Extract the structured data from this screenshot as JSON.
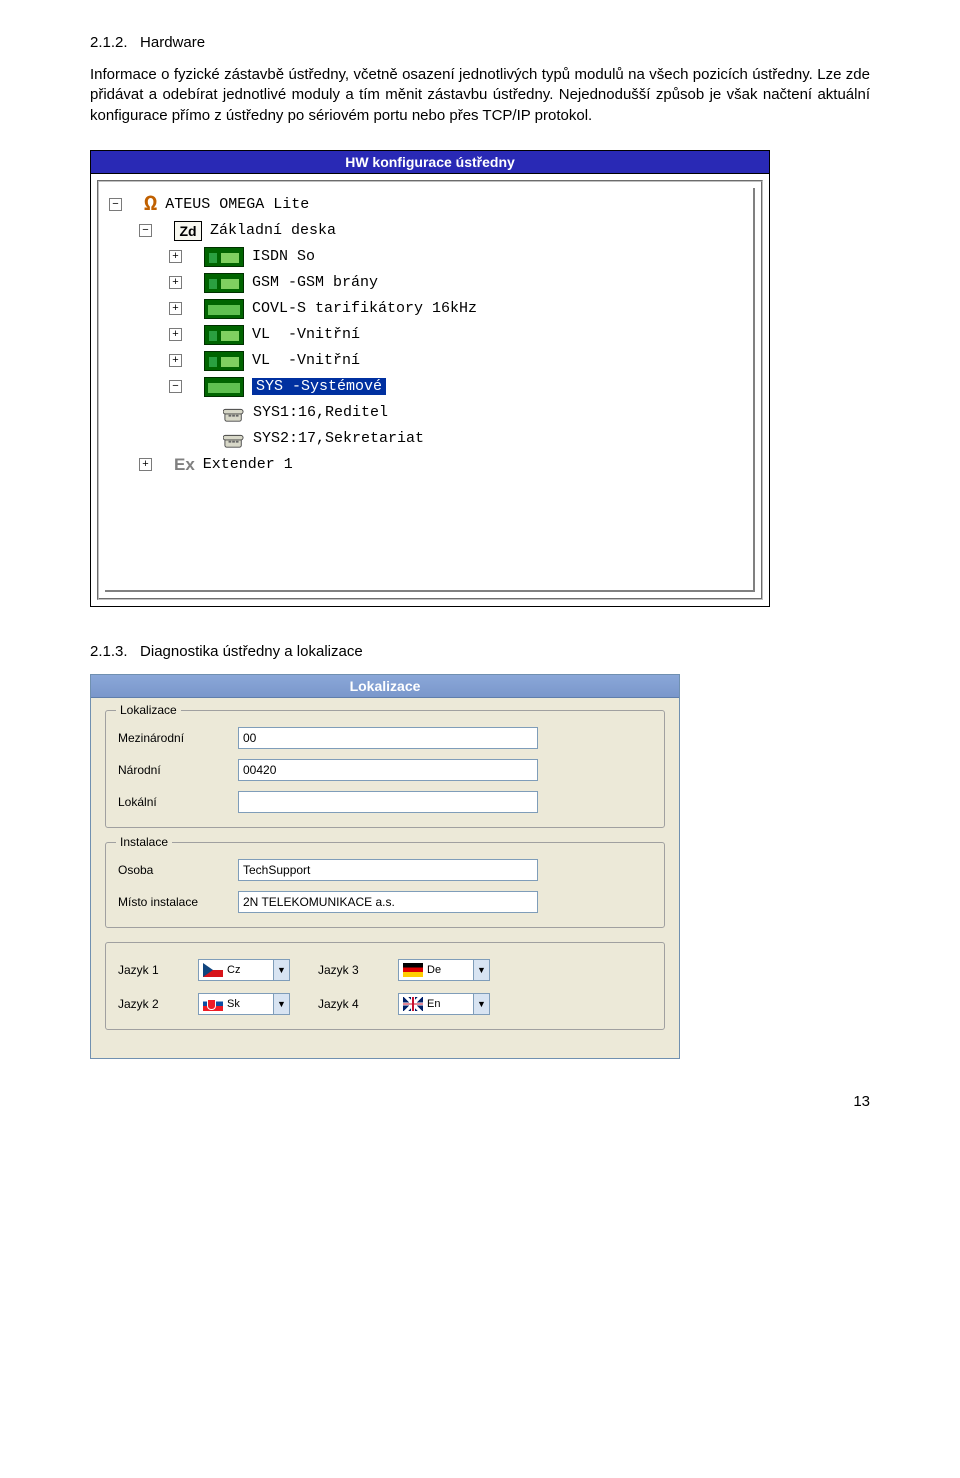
{
  "section1": {
    "num": "2.1.2.",
    "title": "Hardware"
  },
  "para1": "Informace o fyzické zástavbě ústředny, včetně osazení jednotlivých typů modulů na všech pozicích ústředny. Lze zde přidávat a odebírat jednotlivé moduly a tím měnit zástavbu ústředny. Nejednodušší způsob je však načtení aktuální konfigurace přímo z ústředny po sériovém portu nebo přes TCP/IP protokol.",
  "hwwin": {
    "title": "HW konfigurace ústředny",
    "tree": {
      "root": "ATEUS OMEGA Lite",
      "board": "Základní deska",
      "items": [
        "ISDN So",
        "GSM -GSM brány",
        "COVL-S tarifikátory 16kHz",
        "VL  -Vnitřní",
        "VL  -Vnitřní"
      ],
      "sys": "SYS -Systémové",
      "sys1": "SYS1:16,Reditel",
      "sys2": "SYS2:17,Sekretariat",
      "ext": "Extender 1"
    }
  },
  "section2": {
    "num": "2.1.3.",
    "title": "Diagnostika ústředny a lokalizace"
  },
  "locwin": {
    "title": "Lokalizace",
    "g1": {
      "label": "Lokalizace",
      "rows": [
        {
          "label": "Mezinárodní",
          "value": "00"
        },
        {
          "label": "Národní",
          "value": "00420"
        },
        {
          "label": "Lokální",
          "value": ""
        }
      ]
    },
    "g2": {
      "label": "Instalace",
      "rows": [
        {
          "label": "Osoba",
          "value": "TechSupport"
        },
        {
          "label": "Místo instalace",
          "value": "2N TELEKOMUNIKACE a.s."
        }
      ]
    },
    "g3": {
      "langs": [
        {
          "label": "Jazyk 1",
          "code": "Cz",
          "flag": "cz"
        },
        {
          "label": "Jazyk 3",
          "code": "De",
          "flag": "de"
        },
        {
          "label": "Jazyk 2",
          "code": "Sk",
          "flag": "sk"
        },
        {
          "label": "Jazyk 4",
          "code": "En",
          "flag": "en"
        }
      ]
    }
  },
  "pagenum": "13"
}
